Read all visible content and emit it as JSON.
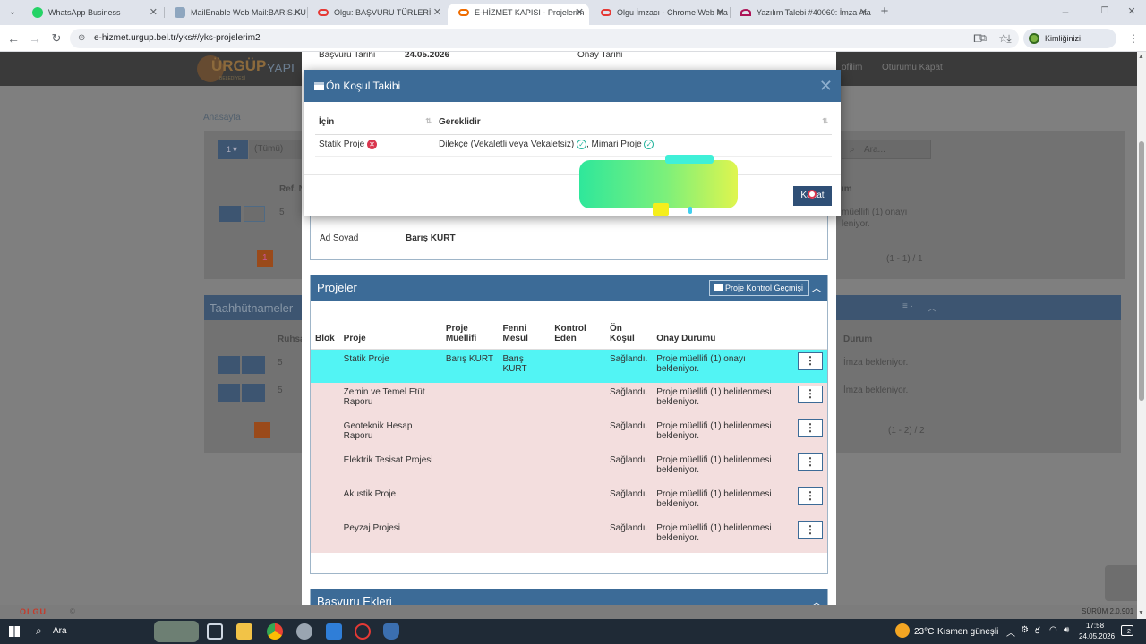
{
  "browser": {
    "tabs": [
      {
        "title": "WhatsApp Business",
        "color": "#25d366"
      },
      {
        "title": "MailEnable Web Mail:BARIS.KU",
        "color": "#5f7f9f"
      },
      {
        "title": "Olgu: BAŞVURU TÜRLERİ",
        "color": "#e53935"
      },
      {
        "title": "E-HİZMET KAPISI - Projelerim",
        "color": "#ef6c00"
      },
      {
        "title": "Olgu İmzacı - Chrome Web Ma",
        "color": "#e53935"
      },
      {
        "title": "Yazılım Talebi #40060: İmza Ata",
        "color": "#ad1457"
      }
    ],
    "active_tab": 3,
    "url": "e-hizmet.urgup.bel.tr/yks#/yks-projelerim2",
    "profile_label": "Kimliğinizi doğrulayın"
  },
  "background_page": {
    "logo_text": "ÜRGÜP",
    "logo_suffix": "YAPI",
    "logo_sub": "BELEDİYESİ",
    "nav_right": [
      "ofilim",
      "Oturumu Kapat"
    ],
    "breadcrumb": "Anasayfa",
    "filter_label": "(Tümü)",
    "search_placeholder": "Ara...",
    "ref_header": "Ref. N",
    "row_count": "5",
    "durum_fragment": "ım",
    "status_fragment_1": "müellifi (1) onayı",
    "status_fragment_2": "leniyor.",
    "pagination_1": "(1 - 1) / 1",
    "page_number": "1",
    "taahhut_title": "Taahhütnameler",
    "ruhsat_header": "Ruhsa",
    "durum_header": "Durum",
    "imza_1": "İmza bekleniyor.",
    "imza_2": "İmza bekleniyor.",
    "pagination_2": "(1 - 2) / 2",
    "olgu_brand": "OLGU",
    "version": "SÜRÜM 2.0.901"
  },
  "application_info": {
    "basvuru_tarihi_label": "Başvuru Tarihi",
    "basvuru_tarihi_value": "24.05.2026",
    "onay_tarihi_label": "Onay Tarihi",
    "ad_soyad_label": "Ad Soyad",
    "ad_soyad_value": "Barış KURT"
  },
  "modal": {
    "title": "Ön Koşul Takibi",
    "columns": [
      "İçin",
      "Gereklidir"
    ],
    "row": {
      "icin": "Statik Proje",
      "gereklidir_1": "Dilekçe (Vekaletli veya Vekaletsiz)",
      "gereklidir_2": "Mimari Proje"
    },
    "close_label": "Kapat"
  },
  "projeler": {
    "title": "Projeler",
    "history_button": "Proje Kontrol Geçmişi",
    "columns": [
      "Blok",
      "Proje",
      "Proje Müellifi",
      "Fenni Mesul",
      "Kontrol Eden",
      "Ön Koşul",
      "Onay Durumu"
    ],
    "rows": [
      {
        "blok": "",
        "proje": "Statik Proje",
        "muellif": "Barış KURT",
        "fenni": "Barış KURT",
        "kontrol": "",
        "onkosul": "Sağlandı.",
        "durum": "Proje müellifi (1) onayı bekleniyor."
      },
      {
        "blok": "",
        "proje": "Zemin ve Temel Etüt Raporu",
        "muellif": "",
        "fenni": "",
        "kontrol": "",
        "onkosul": "Sağlandı.",
        "durum": "Proje müellifi (1) belirlenmesi bekleniyor."
      },
      {
        "blok": "",
        "proje": "Geoteknik Hesap Raporu",
        "muellif": "",
        "fenni": "",
        "kontrol": "",
        "onkosul": "Sağlandı.",
        "durum": "Proje müellifi (1) belirlenmesi bekleniyor."
      },
      {
        "blok": "",
        "proje": "Elektrik Tesisat Projesi",
        "muellif": "",
        "fenni": "",
        "kontrol": "",
        "onkosul": "Sağlandı.",
        "durum": "Proje müellifi (1) belirlenmesi bekleniyor."
      },
      {
        "blok": "",
        "proje": "Akustik Proje",
        "muellif": "",
        "fenni": "",
        "kontrol": "",
        "onkosul": "Sağlandı.",
        "durum": "Proje müellifi (1) belirlenmesi bekleniyor."
      },
      {
        "blok": "",
        "proje": "Peyzaj Projesi",
        "muellif": "",
        "fenni": "",
        "kontrol": "",
        "onkosul": "Sağlandı.",
        "durum": "Proje müellifi (1) belirlenmesi bekleniyor."
      }
    ]
  },
  "basvuru_ekleri": {
    "title": "Başvuru Ekleri"
  },
  "taskbar": {
    "search_label": "Ara",
    "weather_temp": "23°C",
    "weather_text": "Kısmen güneşli",
    "time": "17:58",
    "date": "24.05.2026",
    "notification_count": "2"
  },
  "colors": {
    "panel_header": "#3c6b97",
    "highlight_row": "#52f4f4",
    "pending_row": "#f3dede",
    "kapat_button": "#2f4f76"
  }
}
